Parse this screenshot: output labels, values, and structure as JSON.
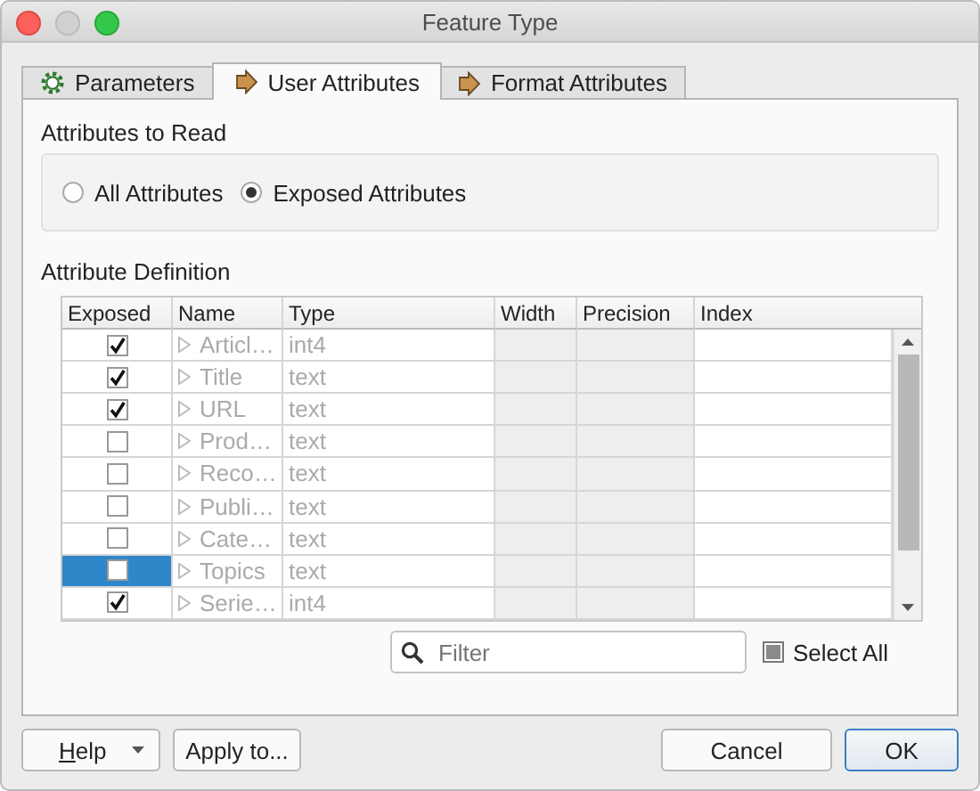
{
  "window": {
    "title": "Feature Type"
  },
  "tabs": [
    {
      "label": "Parameters",
      "kind": "settings",
      "selected": false
    },
    {
      "label": "User Attributes",
      "kind": "attributes",
      "selected": true
    },
    {
      "label": "Format Attributes",
      "kind": "attributes",
      "selected": false
    }
  ],
  "attributes_to_read": {
    "title": "Attributes to Read",
    "options": [
      {
        "label": "All Attributes",
        "selected": false
      },
      {
        "label": "Exposed Attributes",
        "selected": true
      }
    ]
  },
  "attribute_definition": {
    "title": "Attribute Definition",
    "table": {
      "columns": [
        "Exposed",
        "Name",
        "Type",
        "Width",
        "Precision",
        "Index"
      ],
      "rows": [
        {
          "exposed": true,
          "name": "Articl…",
          "type": "int4",
          "selected": false
        },
        {
          "exposed": true,
          "name": "Title",
          "type": "text",
          "selected": false
        },
        {
          "exposed": true,
          "name": "URL",
          "type": "text",
          "selected": false
        },
        {
          "exposed": false,
          "name": "Prod…",
          "type": "text",
          "selected": false
        },
        {
          "exposed": false,
          "name": "Reco…",
          "type": "text",
          "selected": false
        },
        {
          "exposed": false,
          "name": "Publi…",
          "type": "text",
          "selected": false
        },
        {
          "exposed": false,
          "name": "Cate…",
          "type": "text",
          "selected": false
        },
        {
          "exposed": false,
          "name": "Topics",
          "type": "text",
          "selected": true
        },
        {
          "exposed": true,
          "name": "Serie…",
          "type": "int4",
          "selected": false
        }
      ]
    },
    "filter": {
      "placeholder": "Filter"
    },
    "select_all": {
      "label": "Select All",
      "partial": true
    }
  },
  "buttons": {
    "help": "Help",
    "apply": "Apply to...",
    "cancel": "Cancel",
    "ok": "OK"
  }
}
